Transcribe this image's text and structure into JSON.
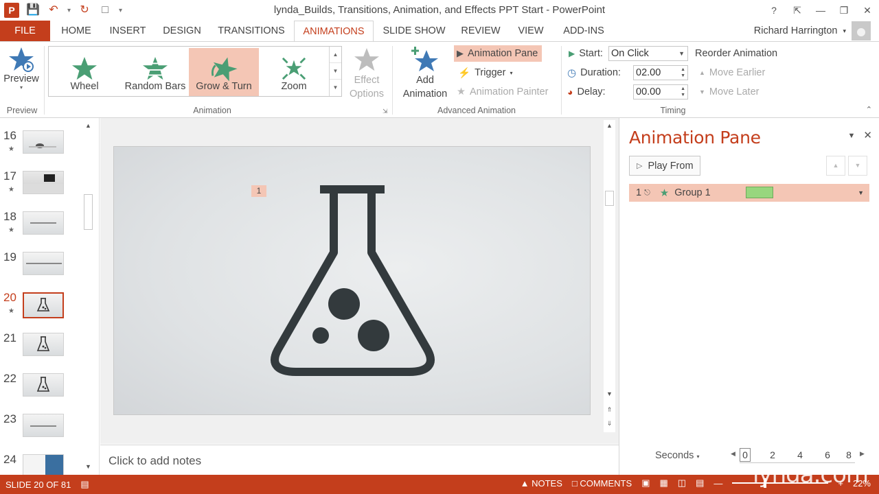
{
  "window": {
    "title": "lynda_Builds, Transitions, Animation, and Effects PPT Start - PowerPoint"
  },
  "tabs": [
    "FILE",
    "HOME",
    "INSERT",
    "DESIGN",
    "TRANSITIONS",
    "ANIMATIONS",
    "SLIDE SHOW",
    "REVIEW",
    "VIEW",
    "ADD-INS"
  ],
  "active_tab": "ANIMATIONS",
  "user": {
    "name": "Richard Harrington"
  },
  "ribbon": {
    "preview": {
      "label": "Preview",
      "group": "Preview"
    },
    "animation_gallery": {
      "items": [
        "Wheel",
        "Random Bars",
        "Grow & Turn",
        "Zoom"
      ],
      "selected": "Grow & Turn",
      "effect_options": "Effect Options",
      "group": "Animation"
    },
    "advanced": {
      "add_animation_1": "Add",
      "add_animation_2": "Animation",
      "animation_pane": "Animation Pane",
      "trigger": "Trigger",
      "animation_painter": "Animation Painter",
      "group": "Advanced Animation"
    },
    "timing": {
      "start_label": "Start:",
      "start_value": "On Click",
      "duration_label": "Duration:",
      "duration_value": "02.00",
      "delay_label": "Delay:",
      "delay_value": "00.00",
      "reorder_title": "Reorder Animation",
      "move_earlier": "Move Earlier",
      "move_later": "Move Later",
      "group": "Timing"
    }
  },
  "slides_pane": {
    "thumbnails": [
      {
        "num": "16",
        "star": true
      },
      {
        "num": "17",
        "star": true
      },
      {
        "num": "18",
        "star": true
      },
      {
        "num": "19",
        "star": false
      },
      {
        "num": "20",
        "star": true
      },
      {
        "num": "21",
        "star": false
      },
      {
        "num": "22",
        "star": false
      },
      {
        "num": "23",
        "star": false
      },
      {
        "num": "24",
        "star": false
      }
    ],
    "selected": "20"
  },
  "slide": {
    "animation_tag": "1"
  },
  "notes": {
    "placeholder": "Click to add notes"
  },
  "animation_pane": {
    "title": "Animation Pane",
    "play_from": "Play From",
    "items": [
      {
        "order": "1",
        "name": "Group 1"
      }
    ],
    "timeline": {
      "unit": "Seconds",
      "ticks": [
        "0",
        "2",
        "4",
        "6",
        "8"
      ]
    }
  },
  "status_bar": {
    "slide_info": "SLIDE 20 OF 81",
    "notes": "NOTES",
    "comments": "COMMENTS",
    "zoom": "22%"
  },
  "watermark": "lynda.com",
  "colors": {
    "accent": "#c43e1c",
    "selection": "#f4c6b5",
    "timeline_bar": "#98d67e"
  }
}
